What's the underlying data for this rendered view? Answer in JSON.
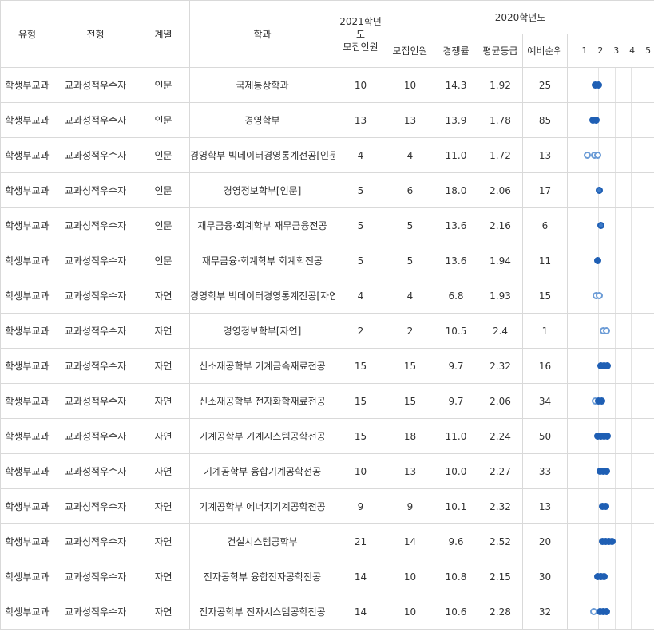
{
  "header": {
    "type": "유형",
    "admission": "전형",
    "track": "계열",
    "dept": "학과",
    "y2021": "2021학년도\n모집인원",
    "y2020": "2020학년도",
    "quota": "모집인원",
    "rate": "경쟁률",
    "avg": "평균등급",
    "waitlist": "예비순위",
    "grades": [
      "1",
      "2",
      "3",
      "4",
      "5"
    ]
  },
  "rows": [
    {
      "type": "학생부교과",
      "adm": "교과성적우수자",
      "track": "인문",
      "dept": "국제통상학과",
      "q21": "10",
      "q20": "10",
      "rate": "14.3",
      "avg": "1.92",
      "wait": "25",
      "dots": [
        {
          "g": 1.92,
          "s": "f",
          "w": 2
        }
      ]
    },
    {
      "type": "학생부교과",
      "adm": "교과성적우수자",
      "track": "인문",
      "dept": "경영학부",
      "q21": "13",
      "q20": "13",
      "rate": "13.9",
      "avg": "1.78",
      "wait": "85",
      "dots": [
        {
          "g": 1.78,
          "s": "f",
          "w": 2
        }
      ]
    },
    {
      "type": "학생부교과",
      "adm": "교과성적우수자",
      "track": "인문",
      "dept": "경영학부 빅데이터경영통계전공[인문]",
      "q21": "4",
      "q20": "4",
      "rate": "11.0",
      "avg": "1.72",
      "wait": "13",
      "dots": [
        {
          "g": 1.3,
          "s": "o",
          "w": 1
        },
        {
          "g": 1.85,
          "s": "o",
          "w": 2
        }
      ]
    },
    {
      "type": "학생부교과",
      "adm": "교과성적우수자",
      "track": "인문",
      "dept": "경영정보학부[인문]",
      "q21": "5",
      "q20": "6",
      "rate": "18.0",
      "avg": "2.06",
      "wait": "17",
      "dots": [
        {
          "g": 2.06,
          "s": "m",
          "w": 1
        }
      ]
    },
    {
      "type": "학생부교과",
      "adm": "교과성적우수자",
      "track": "인문",
      "dept": "재무금융·회계학부 재무금융전공",
      "q21": "5",
      "q20": "5",
      "rate": "13.6",
      "avg": "2.16",
      "wait": "6",
      "dots": [
        {
          "g": 2.16,
          "s": "m",
          "w": 1
        }
      ]
    },
    {
      "type": "학생부교과",
      "adm": "교과성적우수자",
      "track": "인문",
      "dept": "재무금융·회계학부 회계학전공",
      "q21": "5",
      "q20": "5",
      "rate": "13.6",
      "avg": "1.94",
      "wait": "11",
      "dots": [
        {
          "g": 1.94,
          "s": "f",
          "w": 1
        }
      ]
    },
    {
      "type": "학생부교과",
      "adm": "교과성적우수자",
      "track": "자연",
      "dept": "경영학부 빅데이터경영통계전공[자연]",
      "q21": "4",
      "q20": "4",
      "rate": "6.8",
      "avg": "1.93",
      "wait": "15",
      "dots": [
        {
          "g": 1.93,
          "s": "o",
          "w": 2
        }
      ]
    },
    {
      "type": "학생부교과",
      "adm": "교과성적우수자",
      "track": "자연",
      "dept": "경영정보학부[자연]",
      "q21": "2",
      "q20": "2",
      "rate": "10.5",
      "avg": "2.4",
      "wait": "1",
      "dots": [
        {
          "g": 2.4,
          "s": "o",
          "w": 2
        }
      ]
    },
    {
      "type": "학생부교과",
      "adm": "교과성적우수자",
      "track": "자연",
      "dept": "신소재공학부 기계금속재료전공",
      "q21": "15",
      "q20": "15",
      "rate": "9.7",
      "avg": "2.32",
      "wait": "16",
      "dots": [
        {
          "g": 2.32,
          "s": "f",
          "w": 3
        }
      ]
    },
    {
      "type": "학생부교과",
      "adm": "교과성적우수자",
      "track": "자연",
      "dept": "신소재공학부 전자화학재료전공",
      "q21": "15",
      "q20": "15",
      "rate": "9.7",
      "avg": "2.06",
      "wait": "34",
      "dots": [
        {
          "g": 1.8,
          "s": "o",
          "w": 1
        },
        {
          "g": 2.1,
          "s": "f",
          "w": 2
        }
      ]
    },
    {
      "type": "학생부교과",
      "adm": "교과성적우수자",
      "track": "자연",
      "dept": "기계공학부 기계시스템공학전공",
      "q21": "15",
      "q20": "18",
      "rate": "11.0",
      "avg": "2.24",
      "wait": "50",
      "dots": [
        {
          "g": 2.24,
          "s": "f",
          "w": 4
        }
      ]
    },
    {
      "type": "학생부교과",
      "adm": "교과성적우수자",
      "track": "자연",
      "dept": "기계공학부 융합기계공학전공",
      "q21": "10",
      "q20": "13",
      "rate": "10.0",
      "avg": "2.27",
      "wait": "33",
      "dots": [
        {
          "g": 2.27,
          "s": "f",
          "w": 3
        }
      ]
    },
    {
      "type": "학생부교과",
      "adm": "교과성적우수자",
      "track": "자연",
      "dept": "기계공학부 에너지기계공학전공",
      "q21": "9",
      "q20": "9",
      "rate": "10.1",
      "avg": "2.32",
      "wait": "13",
      "dots": [
        {
          "g": 2.32,
          "s": "f",
          "w": 2
        }
      ]
    },
    {
      "type": "학생부교과",
      "adm": "교과성적우수자",
      "track": "자연",
      "dept": "건설시스템공학부",
      "q21": "21",
      "q20": "14",
      "rate": "9.6",
      "avg": "2.52",
      "wait": "20",
      "dots": [
        {
          "g": 2.52,
          "s": "f",
          "w": 4
        }
      ]
    },
    {
      "type": "학생부교과",
      "adm": "교과성적우수자",
      "track": "자연",
      "dept": "전자공학부 융합전자공학전공",
      "q21": "14",
      "q20": "10",
      "rate": "10.8",
      "avg": "2.15",
      "wait": "30",
      "dots": [
        {
          "g": 2.15,
          "s": "f",
          "w": 3
        }
      ]
    },
    {
      "type": "학생부교과",
      "adm": "교과성적우수자",
      "track": "자연",
      "dept": "전자공학부 전자시스템공학전공",
      "q21": "14",
      "q20": "10",
      "rate": "10.6",
      "avg": "2.28",
      "wait": "32",
      "dots": [
        {
          "g": 1.7,
          "s": "o",
          "w": 1
        },
        {
          "g": 2.3,
          "s": "f",
          "w": 3
        }
      ]
    }
  ]
}
